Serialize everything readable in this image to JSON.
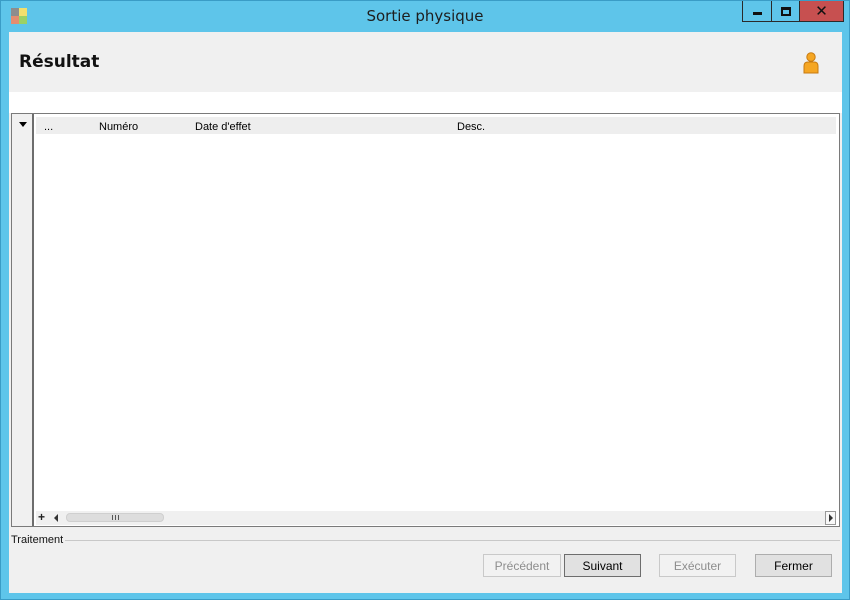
{
  "window": {
    "title": "Sortie physique",
    "icon": "application-icon",
    "controls": [
      "minimize-icon",
      "maximize-icon",
      "close-icon"
    ]
  },
  "header": {
    "title": "Résultat",
    "user_icon": "user-icon"
  },
  "grid": {
    "columns": [
      "...",
      "Numéro",
      "Date d'effet",
      "Desc."
    ],
    "rows": []
  },
  "groupbox": {
    "label": "Traitement"
  },
  "buttons": {
    "previous": "Précédent",
    "next": "Suivant",
    "execute": "Exécuter",
    "close": "Fermer"
  },
  "colors": {
    "title_bar": "#5ec5ea",
    "close_button": "#c75050",
    "client_background": "#f0f0f0"
  }
}
